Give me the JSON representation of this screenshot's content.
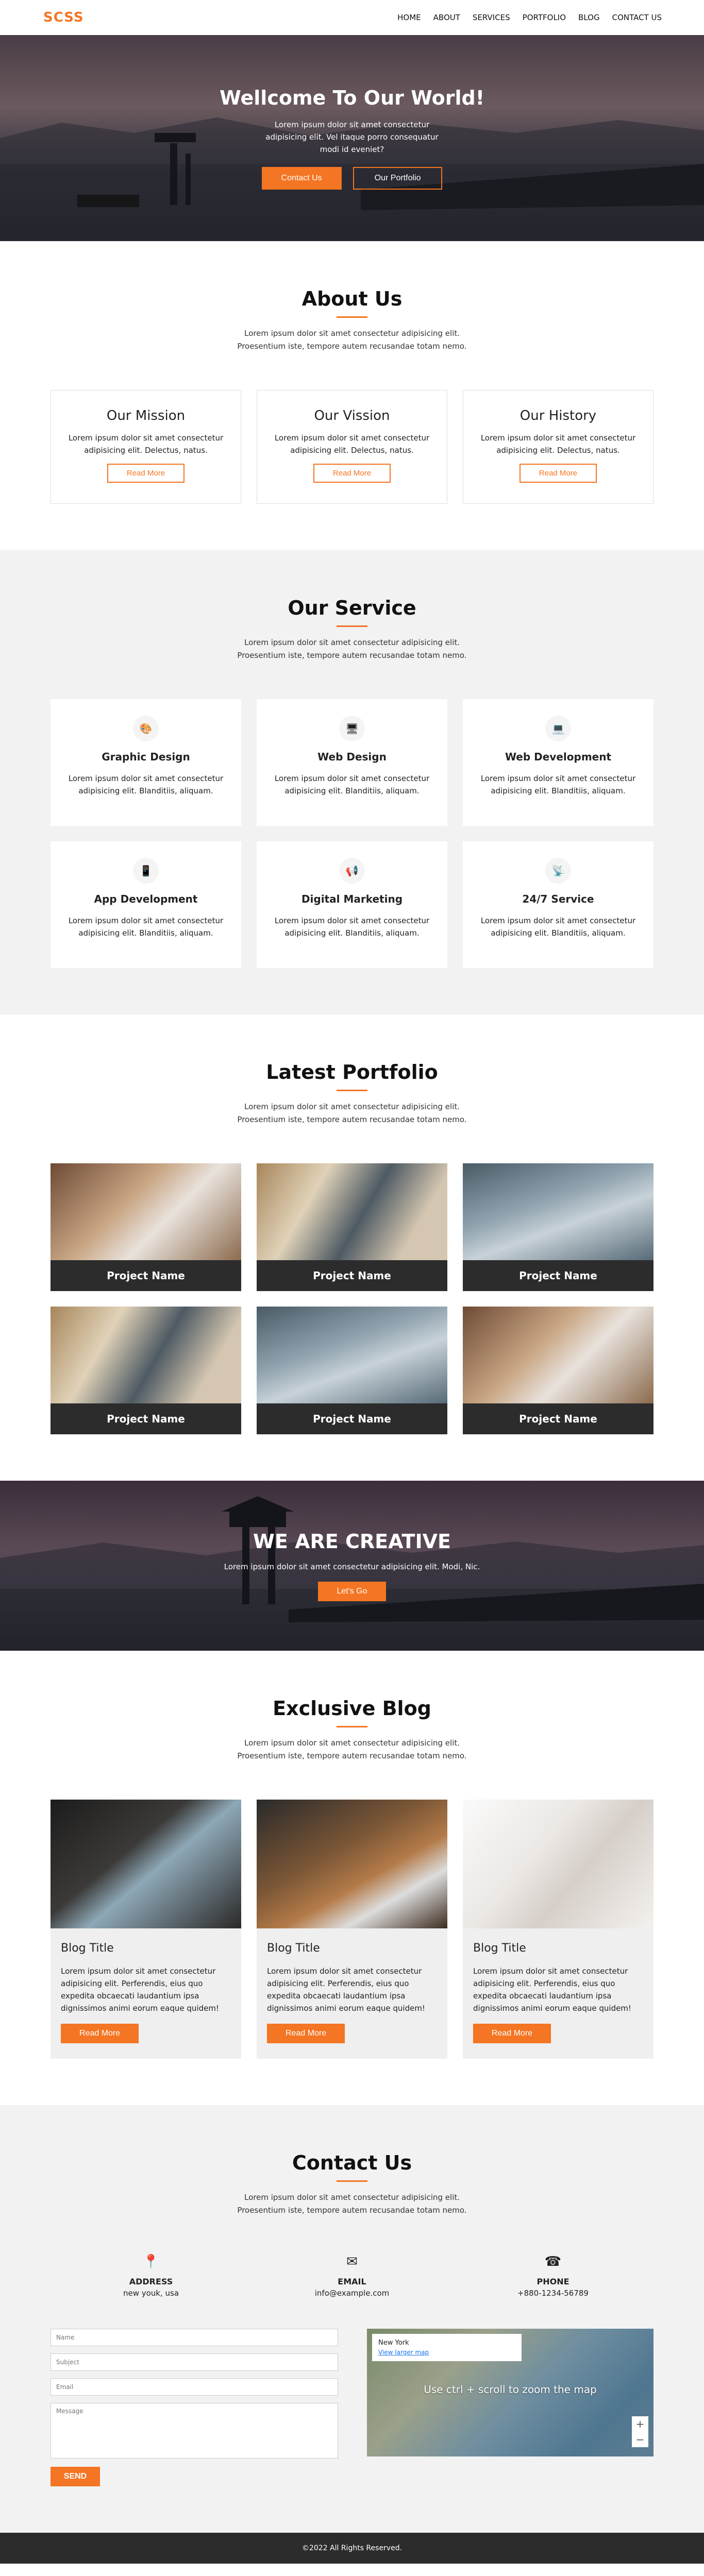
{
  "brand": {
    "logo": "SCSS",
    "accent": "#f47523"
  },
  "nav": [
    "HOME",
    "ABOUT",
    "SERVICES",
    "PORTFOLIO",
    "BLOG",
    "CONTACT US"
  ],
  "hero": {
    "title": "Wellcome To Our World!",
    "text": "Lorem ipsum dolor sit amet consectetur adipisicing elit. Vel itaque porro consequatur modi id eveniet?",
    "btn_contact": "Contact Us",
    "btn_portfolio": "Our Portfolio"
  },
  "about": {
    "title": "About Us",
    "subtitle": "Lorem ipsum dolor sit amet consectetur adipisicing elit. Proesentium iste, tempore autem recusandae totam nemo.",
    "cards": [
      {
        "title": "Our Mission",
        "text": "Lorem ipsum dolor sit amet consectetur adipisicing elit. Delectus, natus.",
        "btn": "Read More"
      },
      {
        "title": "Our Vission",
        "text": "Lorem ipsum dolor sit amet consectetur adipisicing elit. Delectus, natus.",
        "btn": "Read More"
      },
      {
        "title": "Our History",
        "text": "Lorem ipsum dolor sit amet consectetur adipisicing elit. Delectus, natus.",
        "btn": "Read More"
      }
    ]
  },
  "service": {
    "title": "Our Service",
    "subtitle": "Lorem ipsum dolor sit amet consectetur adipisicing elit. Proesentium iste, tempore autem recusandae totam nemo.",
    "items": [
      {
        "icon": "palette-icon",
        "glyph": "🎨",
        "title": "Graphic Design",
        "text": "Lorem ipsum dolor sit amet consectetur adipisicing elit. Blanditiis, aliquam."
      },
      {
        "icon": "desktop-icon",
        "glyph": "🖥",
        "title": "Web Design",
        "text": "Lorem ipsum dolor sit amet consectetur adipisicing elit. Blanditiis, aliquam."
      },
      {
        "icon": "laptop-icon",
        "glyph": "💻",
        "title": "Web Development",
        "text": "Lorem ipsum dolor sit amet consectetur adipisicing elit. Blanditiis, aliquam."
      },
      {
        "icon": "mobile-icon",
        "glyph": "📱",
        "title": "App Development",
        "text": "Lorem ipsum dolor sit amet consectetur adipisicing elit. Blanditiis, aliquam."
      },
      {
        "icon": "ad-icon",
        "glyph": "📢",
        "title": "Digital Marketing",
        "text": "Lorem ipsum dolor sit amet consectetur adipisicing elit. Blanditiis, aliquam."
      },
      {
        "icon": "rss-icon",
        "glyph": "📡",
        "title": "24/7 Service",
        "text": "Lorem ipsum dolor sit amet consectetur adipisicing elit. Blanditiis, aliquam."
      }
    ]
  },
  "portfolio": {
    "title": "Latest Portfolio",
    "subtitle": "Lorem ipsum dolor sit amet consectetur adipisicing elit. Proesentium iste, tempore autem recusandae totam nemo.",
    "items": [
      "Project Name",
      "Project Name",
      "Project Name",
      "Project Name",
      "Project Name",
      "Project Name"
    ]
  },
  "creative": {
    "title": "WE ARE CREATIVE",
    "text": "Lorem ipsum dolor sit amet consectetur adipisicing elit. Modi, Nic.",
    "btn": "Let's Go"
  },
  "blog": {
    "title": "Exclusive Blog",
    "subtitle": "Lorem ipsum dolor sit amet consectetur adipisicing elit. Proesentium iste, tempore autem recusandae totam nemo.",
    "posts": [
      {
        "title": "Blog Title",
        "text": "Lorem ipsum dolor sit amet consectetur adipisicing elit. Perferendis, eius quo expedita obcaecati laudantium ipsa dignissimos animi eorum eaque quidem!",
        "btn": "Read More"
      },
      {
        "title": "Blog Title",
        "text": "Lorem ipsum dolor sit amet consectetur adipisicing elit. Perferendis, eius quo expedita obcaecati laudantium ipsa dignissimos animi eorum eaque quidem!",
        "btn": "Read More"
      },
      {
        "title": "Blog Title",
        "text": "Lorem ipsum dolor sit amet consectetur adipisicing elit. Perferendis, eius quo expedita obcaecati laudantium ipsa dignissimos animi eorum eaque quidem!",
        "btn": "Read More"
      }
    ]
  },
  "contact": {
    "title": "Contact Us",
    "subtitle": "Lorem ipsum dolor sit amet consectetur adipisicing elit. Proesentium iste, tempore autem recusandae totam nemo.",
    "address_label": "ADDRESS",
    "address_value": "new youk, usa",
    "email_label": "EMAIL",
    "email_value": "info@example.com",
    "phone_label": "PHONE",
    "phone_value": "+880-1234-56789",
    "form": {
      "name": "Name",
      "subject": "Subject",
      "email": "Email",
      "message": "Message",
      "send": "SEND"
    },
    "map": {
      "place": "New York",
      "link": "View larger map",
      "hint": "Use ctrl + scroll to zoom the map"
    }
  },
  "footer": {
    "text": "©2022 All Rights Reserved."
  }
}
